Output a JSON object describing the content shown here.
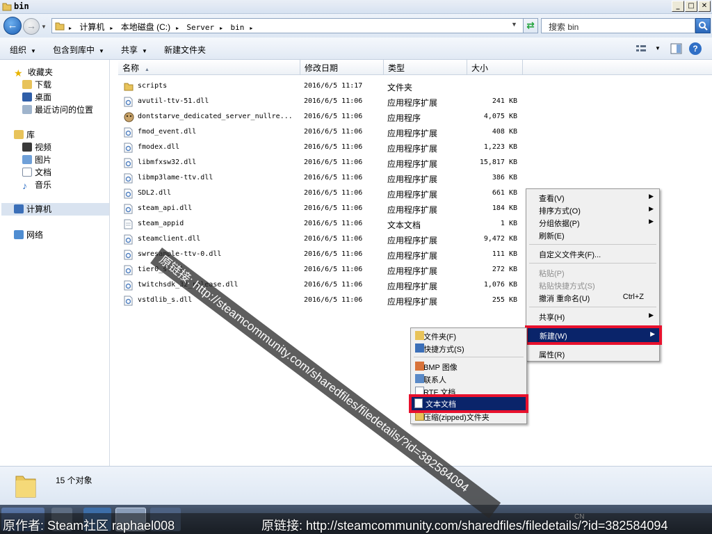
{
  "window": {
    "title": "bin",
    "min": "_",
    "max": "□",
    "close": "✕"
  },
  "address": {
    "crumbs": [
      "计算机",
      "本地磁盘 (C:)",
      "Server",
      "bin"
    ],
    "search_placeholder": "搜索 bin"
  },
  "toolbar": {
    "organize": "组织",
    "include": "包含到库中",
    "share": "共享",
    "new_folder": "新建文件夹"
  },
  "nav": {
    "favorites": "收藏夹",
    "downloads": "下载",
    "desktop": "桌面",
    "recent": "最近访问的位置",
    "libraries": "库",
    "videos": "视频",
    "pictures": "图片",
    "documents": "文档",
    "music": "音乐",
    "computer": "计算机",
    "network": "网络"
  },
  "columns": {
    "name": "名称",
    "date": "修改日期",
    "type": "类型",
    "size": "大小"
  },
  "files": [
    {
      "name": "scripts",
      "date": "2016/6/5 11:17",
      "type": "文件夹",
      "size": ""
    },
    {
      "name": "avutil-ttv-51.dll",
      "date": "2016/6/5 11:06",
      "type": "应用程序扩展",
      "size": "241 KB"
    },
    {
      "name": "dontstarve_dedicated_server_nullre...",
      "date": "2016/6/5 11:06",
      "type": "应用程序",
      "size": "4,075 KB"
    },
    {
      "name": "fmod_event.dll",
      "date": "2016/6/5 11:06",
      "type": "应用程序扩展",
      "size": "408 KB"
    },
    {
      "name": "fmodex.dll",
      "date": "2016/6/5 11:06",
      "type": "应用程序扩展",
      "size": "1,223 KB"
    },
    {
      "name": "libmfxsw32.dll",
      "date": "2016/6/5 11:06",
      "type": "应用程序扩展",
      "size": "15,817 KB"
    },
    {
      "name": "libmp3lame-ttv.dll",
      "date": "2016/6/5 11:06",
      "type": "应用程序扩展",
      "size": "386 KB"
    },
    {
      "name": "SDL2.dll",
      "date": "2016/6/5 11:06",
      "type": "应用程序扩展",
      "size": "661 KB"
    },
    {
      "name": "steam_api.dll",
      "date": "2016/6/5 11:06",
      "type": "应用程序扩展",
      "size": "184 KB"
    },
    {
      "name": "steam_appid",
      "date": "2016/6/5 11:06",
      "type": "文本文档",
      "size": "1 KB"
    },
    {
      "name": "steamclient.dll",
      "date": "2016/6/5 11:06",
      "type": "应用程序扩展",
      "size": "9,472 KB"
    },
    {
      "name": "swresample-ttv-0.dll",
      "date": "2016/6/5 11:06",
      "type": "应用程序扩展",
      "size": "111 KB"
    },
    {
      "name": "tier0_s.dll",
      "date": "2016/6/5 11:06",
      "type": "应用程序扩展",
      "size": "272 KB"
    },
    {
      "name": "twitchsdk_32_release.dll",
      "date": "2016/6/5 11:06",
      "type": "应用程序扩展",
      "size": "1,076 KB"
    },
    {
      "name": "vstdlib_s.dll",
      "date": "2016/6/5 11:06",
      "type": "应用程序扩展",
      "size": "255 KB"
    }
  ],
  "context_menu": {
    "view": "查看(V)",
    "sort": "排序方式(O)",
    "group": "分组依据(P)",
    "refresh": "刷新(E)",
    "customize": "自定义文件夹(F)...",
    "paste": "粘贴(P)",
    "paste_shortcut": "粘贴快捷方式(S)",
    "undo": "撤消 重命名(U)",
    "undo_shortcut": "Ctrl+Z",
    "share": "共享(H)",
    "new": "新建(W)",
    "properties": "属性(R)"
  },
  "submenu": {
    "folder": "文件夹(F)",
    "shortcut": "快捷方式(S)",
    "bmp": "BMP 图像",
    "contact": "联系人",
    "rtf": "RTF 文档",
    "txt": "文本文档",
    "zip": "压缩(zipped)文件夹"
  },
  "status": {
    "count": "15 个对象"
  },
  "watermark": {
    "author": "原作者: Steam社区 raphael008",
    "link": "原链接: http://steamcommunity.com/sharedfiles/filedetails/?id=382584094"
  },
  "colors": {
    "highlight": "#0a246a",
    "red_frame": "#e8112d"
  }
}
